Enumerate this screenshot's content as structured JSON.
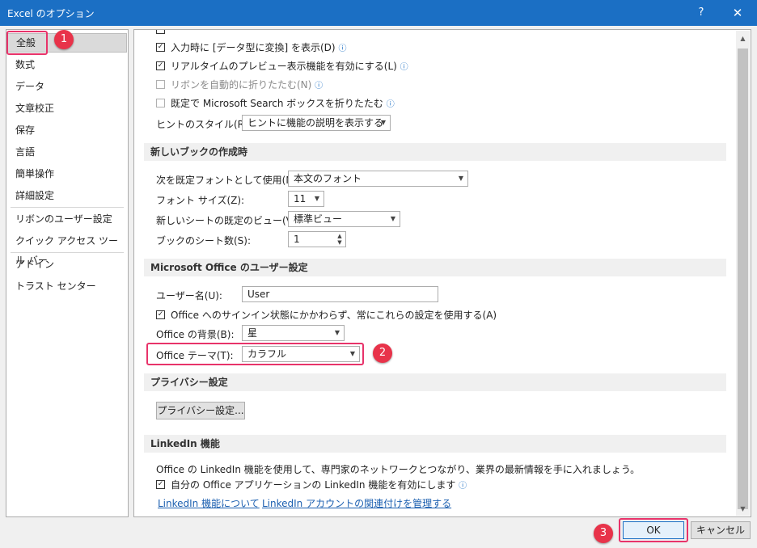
{
  "window": {
    "title": "Excel のオプション",
    "help": "?",
    "close": "✕"
  },
  "sidebar": {
    "items": [
      "全般",
      "数式",
      "データ",
      "文章校正",
      "保存",
      "言語",
      "簡単操作",
      "詳細設定",
      "リボンのユーザー設定",
      "クイック アクセス ツール バー",
      "アドイン",
      "トラスト センター"
    ],
    "selected_index": 0
  },
  "ui_options": {
    "data_type_convert": {
      "label": "入力時に [データ型に変換] を表示(D)",
      "checked": true
    },
    "live_preview": {
      "label": "リアルタイムのプレビュー表示機能を有効にする(L)",
      "checked": true
    },
    "collapse_ribbon": {
      "label": "リボンを自動的に折りたたむ(N)",
      "checked": false
    },
    "collapse_search": {
      "label": "既定で Microsoft Search ボックスを折りたたむ",
      "checked": false
    },
    "tooltip_style": {
      "label": "ヒントのスタイル(R):",
      "value": "ヒントに機能の説明を表示する"
    }
  },
  "new_workbook": {
    "header": "新しいブックの作成時",
    "font": {
      "label": "次を既定フォントとして使用(N):",
      "value": "本文のフォント"
    },
    "font_size": {
      "label": "フォント サイズ(Z):",
      "value": "11"
    },
    "view": {
      "label": "新しいシートの既定のビュー(V):",
      "value": "標準ビュー"
    },
    "sheets": {
      "label": "ブックのシート数(S):",
      "value": "1"
    }
  },
  "personalize": {
    "header": "Microsoft Office のユーザー設定",
    "username": {
      "label": "ユーザー名(U):",
      "value": "User"
    },
    "always_use": {
      "label": "Office へのサインイン状態にかかわらず、常にこれらの設定を使用する(A)",
      "checked": true
    },
    "background": {
      "label": "Office の背景(B):",
      "value": "星"
    },
    "theme": {
      "label": "Office テーマ(T):",
      "value": "カラフル"
    }
  },
  "privacy": {
    "header": "プライバシー設定",
    "button": "プライバシー設定..."
  },
  "linkedin": {
    "header": "LinkedIn 機能",
    "description": "Office の LinkedIn 機能を使用して、専門家のネットワークとつながり、業界の最新情報を手に入れましょう。",
    "enable": {
      "label": "自分の Office アプリケーションの LinkedIn 機能を有効にします",
      "checked": true
    },
    "link_about": "LinkedIn 機能について",
    "link_manage": "LinkedIn アカウントの関連付けを管理する"
  },
  "footer": {
    "ok": "OK",
    "cancel": "キャンセル"
  },
  "annotations": {
    "badge1": "1",
    "badge2": "2",
    "badge3": "3",
    "color": "#e8336a"
  },
  "icons": {
    "info": "info-icon",
    "check": "check-icon",
    "dropdown": "chevron-down-icon"
  },
  "colors": {
    "titlebar": "#1b6fc4",
    "link": "#1b5fb0"
  }
}
